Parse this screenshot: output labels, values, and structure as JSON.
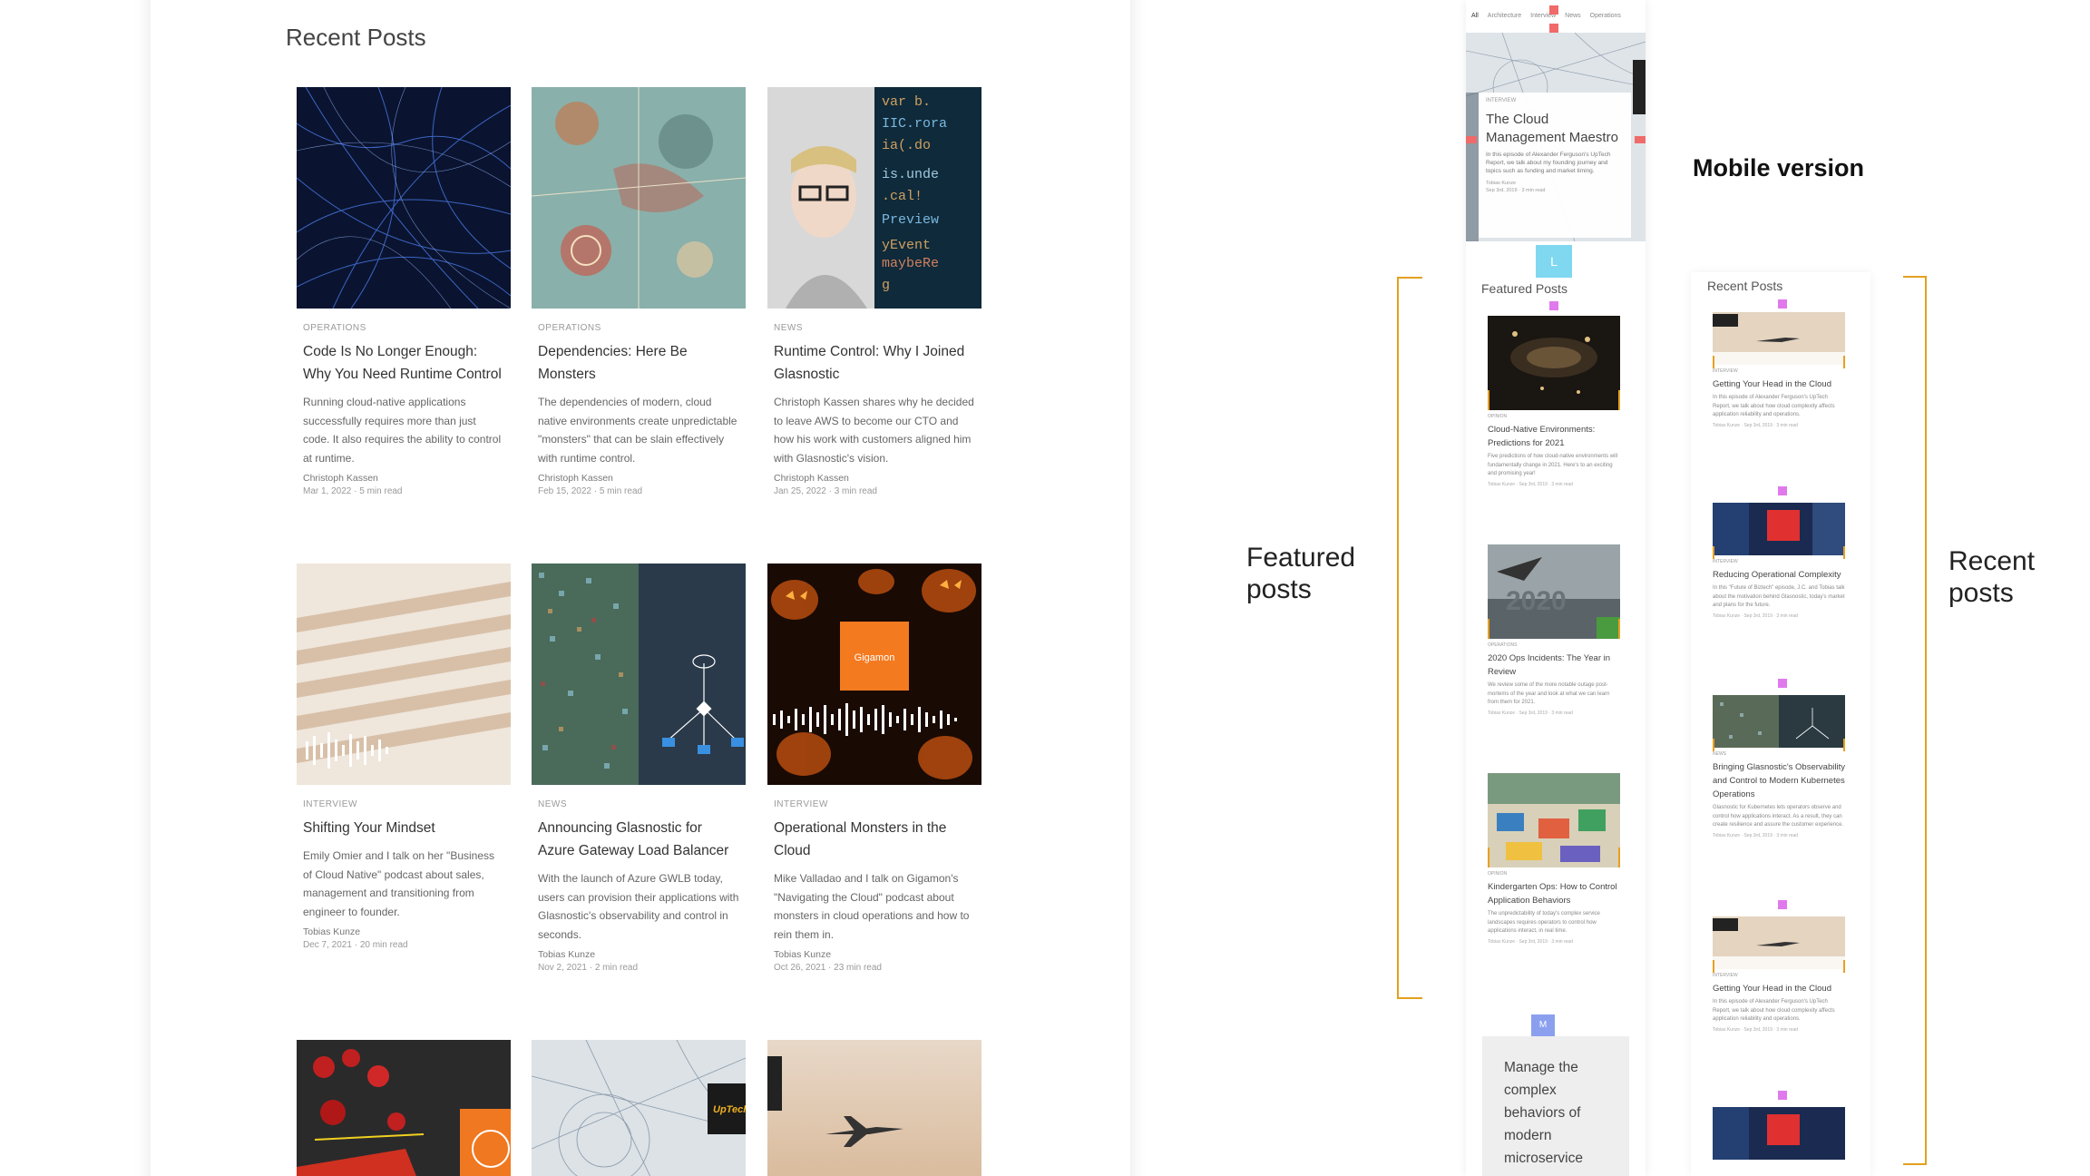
{
  "desktop": {
    "section_title": "Recent Posts",
    "posts": [
      {
        "category": "OPERATIONS",
        "title": "Code Is No Longer Enough: Why You Need Runtime Control",
        "excerpt": "Running cloud-native applications successfully requires more than just code. It also requires the ability to control at runtime.",
        "author": "Christoph Kassen",
        "date": "Mar 1, 2022 · 5 min read"
      },
      {
        "category": "OPERATIONS",
        "title": "Dependencies: Here Be Monsters",
        "excerpt": "The dependencies of modern, cloud native environments create unpredictable \"monsters\" that can be slain effectively with runtime control.",
        "author": "Christoph Kassen",
        "date": "Feb 15, 2022 · 5 min read"
      },
      {
        "category": "NEWS",
        "title": "Runtime Control: Why I Joined Glasnostic",
        "excerpt": "Christoph Kassen shares why he decided to leave AWS to become our CTO and how his work with customers aligned him with Glasnostic's vision.",
        "author": "Christoph Kassen",
        "date": "Jan 25, 2022 · 3 min read"
      },
      {
        "category": "INTERVIEW",
        "title": "Shifting Your Mindset",
        "excerpt": "Emily Omier and I talk on her \"Business of Cloud Native\" podcast about sales, management and transitioning from engineer to founder.",
        "author": "Tobias Kunze",
        "date": "Dec 7, 2021 · 20 min read"
      },
      {
        "category": "NEWS",
        "title": "Announcing Glasnostic for Azure Gateway Load Balancer",
        "excerpt": "With the launch of Azure GWLB today, users can provision their applications with Glasnostic's observability and control in seconds.",
        "author": "Tobias Kunze",
        "date": "Nov 2, 2021 · 2 min read"
      },
      {
        "category": "INTERVIEW",
        "title": "Operational Monsters in the Cloud",
        "excerpt": "Mike Valladao and I talk on Gigamon's \"Navigating the Cloud\" podcast about monsters in cloud operations and how to rein them in.",
        "author": "Tobias Kunze",
        "date": "Oct 26, 2021 · 23 min read"
      }
    ],
    "gigamon_logo": "Gigamon",
    "uptech_logo": "UpTech"
  },
  "mobile": {
    "tabs": [
      "All",
      "Architecture",
      "Interview",
      "News",
      "Operations"
    ],
    "hero": {
      "category": "INTERVIEW",
      "title": "The Cloud Management Maestro",
      "excerpt": "In this episode of Alexander Ferguson's UpTech Report, we talk about my founding journey and topics such as funding and market timing.",
      "author": "Tobias Kunze",
      "date": "Sep 3rd, 2019 · 3 min read"
    },
    "marker_l": "L",
    "marker_m": "M",
    "featured_heading": "Featured Posts",
    "featured": [
      {
        "category": "OPINION",
        "title": "Cloud-Native Environments: Predictions for 2021",
        "excerpt": "Five predictions of how cloud-native environments will fundamentally change in 2021. Here's to an exciting and promising year!",
        "meta": "Tobias Kunze · Sep 3rd, 2019 · 3 min read"
      },
      {
        "category": "OPERATIONS",
        "title": "2020 Ops Incidents: The Year in Review",
        "excerpt": "We review some of the more notable outage post-mortems of the year and look at what we can learn from them for 2021.",
        "meta": "Tobias Kunze · Sep 3rd, 2019 · 3 min read"
      },
      {
        "category": "OPINION",
        "title": "Kindergarten Ops: How to Control Application Behaviors",
        "excerpt": "The unpredictability of today's complex service landscapes requires operators to control how applications interact, in real time.",
        "meta": "Tobias Kunze · Sep 3rd, 2019 · 3 min read"
      }
    ],
    "cta_text": "Manage the complex behaviors of modern microservice",
    "recent_heading": "Recent Posts",
    "recent": [
      {
        "category": "INTERVIEW",
        "title": "Getting Your Head in the Cloud",
        "excerpt": "In this episode of Alexander Ferguson's UpTech Report, we talk about how cloud complexity affects application reliability and operations.",
        "meta": "Tobias Kunze · Sep 3rd, 2019 · 3 min read"
      },
      {
        "category": "INTERVIEW",
        "title": "Reducing Operational Complexity",
        "excerpt": "In this \"Future of Biztech\" episode, J.C. and Tobias talk about the motivation behind Glasnostic, today's market and plans for the future.",
        "meta": "Tobias Kunze · Sep 3rd, 2019 · 3 min read"
      },
      {
        "category": "NEWS",
        "title": "Bringing Glasnostic's Observability and Control to Modern Kubernetes Operations",
        "excerpt": "Glasnostic for Kubernetes lets operators observe and control how applications interact. As a result, they can create resilience and assure the customer experience.",
        "meta": "Tobias Kunze · Sep 3rd, 2019 · 3 min read"
      },
      {
        "category": "INTERVIEW",
        "title": "Getting Your Head in the Cloud",
        "excerpt": "In this episode of Alexander Ferguson's UpTech Report, we talk about how cloud complexity affects application reliability and operations.",
        "meta": "Tobias Kunze · Sep 3rd, 2019 · 3 min read"
      }
    ]
  },
  "annotations": {
    "mobile_version": "Mobile version",
    "featured_line1": "Featured",
    "featured_line2": "posts",
    "recent_line1": "Recent",
    "recent_line2": "posts"
  },
  "colors": {
    "bracket": "#e3a020",
    "marker_red": "#f06a6a",
    "marker_pink": "#e07aec",
    "marker_cyan": "#7fd8f0",
    "marker_blue": "#8aa0ef",
    "orange_mark": "#e8a020"
  }
}
